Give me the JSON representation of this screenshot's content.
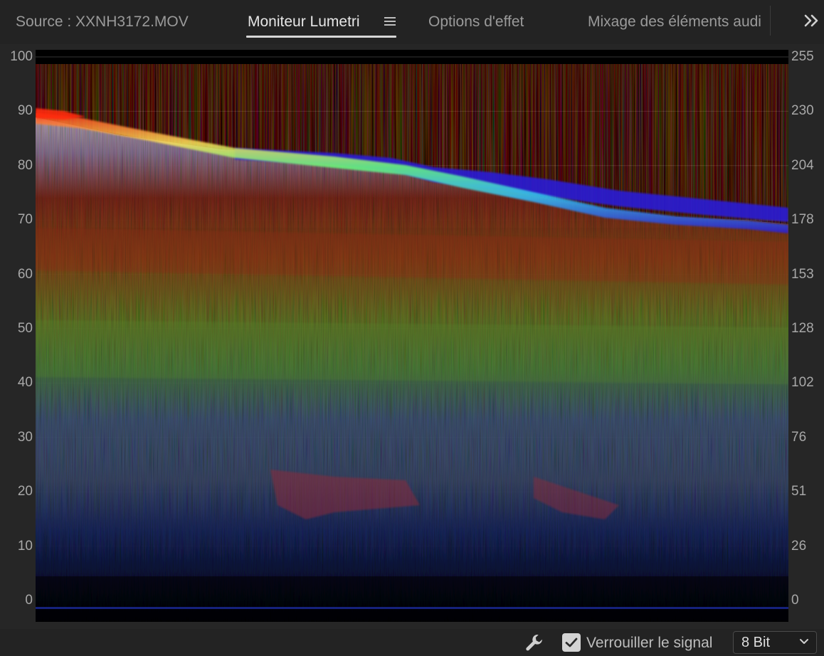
{
  "tabs": {
    "source": "Source : XXNH3172.MOV",
    "lumetri": "Moniteur Lumetri",
    "options": "Options d'effet",
    "mixage": "Mixage des éléments audi"
  },
  "icons": {
    "panel_menu": "hamburger-menu-icon",
    "overflow": "double-chevron-right-icon",
    "settings": "wrench-icon",
    "checkbox": "checkmark-icon",
    "dropdown": "chevron-down-icon"
  },
  "scope": {
    "type": "rgb-parade-waveform",
    "left_scale": [
      "100",
      "90",
      "80",
      "70",
      "60",
      "50",
      "40",
      "30",
      "20",
      "10",
      "0"
    ],
    "right_scale": [
      "255",
      "230",
      "204",
      "178",
      "153",
      "128",
      "102",
      "76",
      "51",
      "26",
      "0"
    ]
  },
  "toolbar": {
    "lock_signal_label": "Verrouiller le signal",
    "lock_signal_checked": true,
    "bit_depth": "8 Bit"
  },
  "colors": {
    "panel_bg": "#232323",
    "scope_bg": "#000000",
    "active_tab": "#e6e6e6",
    "inactive_tab": "#9a9a9a"
  }
}
